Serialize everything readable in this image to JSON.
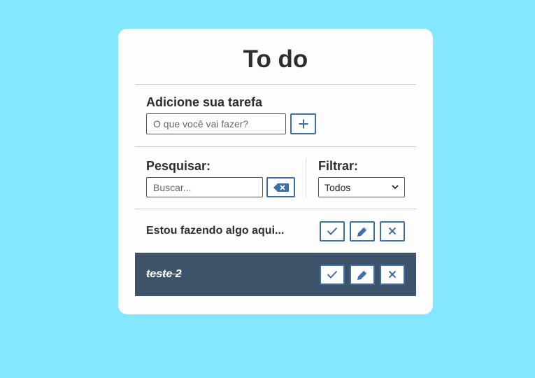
{
  "app": {
    "title": "To do"
  },
  "add": {
    "label": "Adicione sua tarefa",
    "placeholder": "O que você vai fazer?",
    "value": ""
  },
  "search": {
    "label": "Pesquisar:",
    "placeholder": "Buscar...",
    "value": ""
  },
  "filter": {
    "label": "Filtrar:",
    "selected": "Todos"
  },
  "todos": [
    {
      "text": "Estou fazendo algo aqui...",
      "done": false
    },
    {
      "text": "teste 2",
      "done": true
    }
  ],
  "colors": {
    "background": "#84e6ff",
    "accent": "#3d6ea8",
    "done_row": "#3d5369"
  },
  "icons": {
    "add": "plus-icon",
    "clear": "backspace-icon",
    "select": "chevron-down-icon",
    "finish": "check-icon",
    "edit": "pencil-icon",
    "remove": "close-icon"
  }
}
